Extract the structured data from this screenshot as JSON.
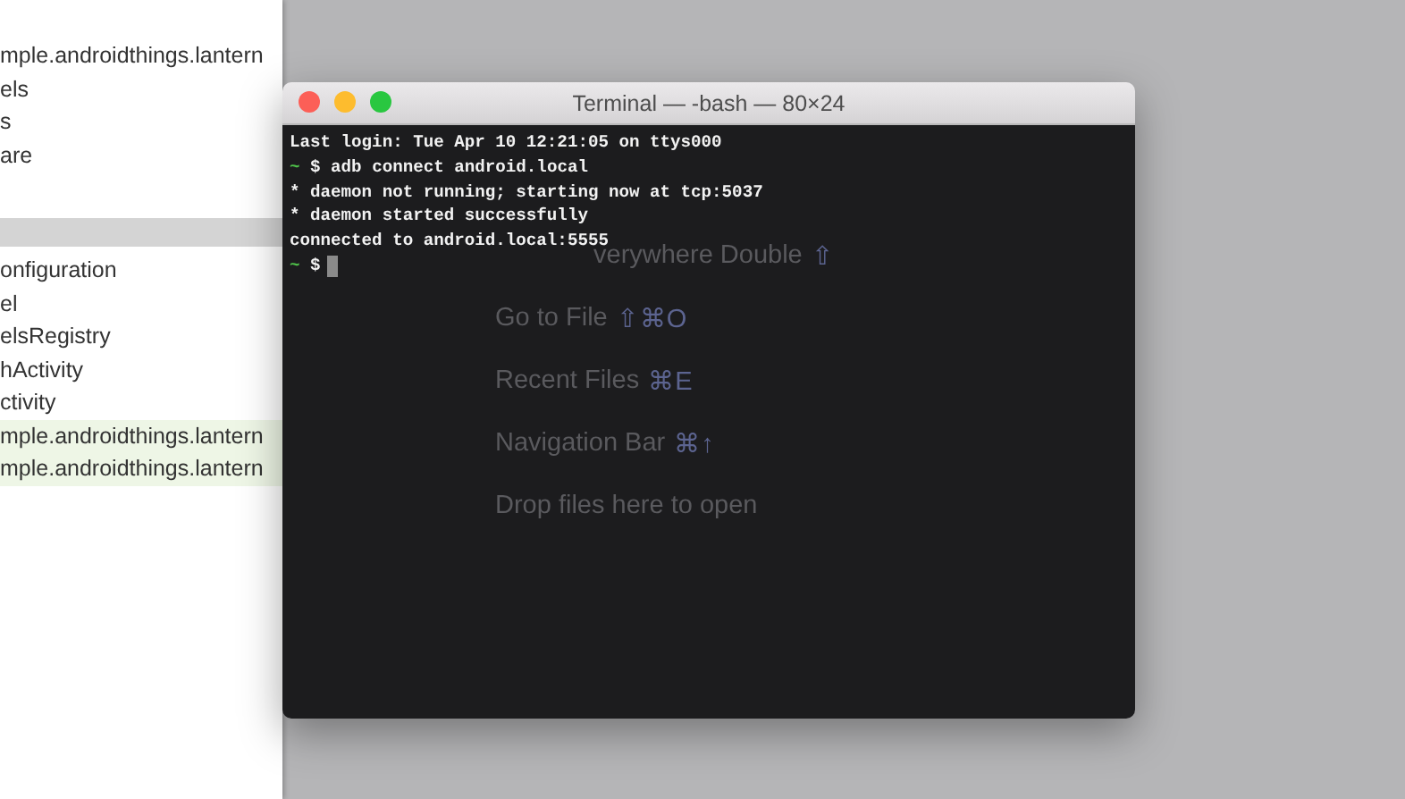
{
  "sidebar": {
    "items": [
      {
        "label": "mple.androidthings.lantern",
        "selected": false,
        "modified": false
      },
      {
        "label": "els",
        "selected": false,
        "modified": false
      },
      {
        "label": "s",
        "selected": false,
        "modified": false
      },
      {
        "label": "are",
        "selected": false,
        "modified": false
      },
      {
        "selected": true,
        "modified": false
      },
      {
        "label": "onfiguration",
        "selected": false,
        "modified": false
      },
      {
        "label": "el",
        "selected": false,
        "modified": false
      },
      {
        "label": "elsRegistry",
        "selected": false,
        "modified": false
      },
      {
        "label": "hActivity",
        "selected": false,
        "modified": false
      },
      {
        "label": "ctivity",
        "selected": false,
        "modified": false
      },
      {
        "label": "mple.androidthings.lantern",
        "selected": false,
        "modified": true
      },
      {
        "label": "mple.androidthings.lantern",
        "selected": false,
        "modified": true
      }
    ]
  },
  "background_hints": [
    {
      "text": "verywhere Double",
      "shortcut": "⇧"
    },
    {
      "text": "Go to File",
      "shortcut": "⇧⌘O"
    },
    {
      "text": "Recent Files",
      "shortcut": "⌘E"
    },
    {
      "text": "Navigation Bar",
      "shortcut": "⌘↑"
    },
    {
      "text": "Drop files here to open"
    }
  ],
  "terminal": {
    "title": "Terminal — -bash — 80×24",
    "lines": [
      {
        "kind": "output",
        "text": "Last login: Tue Apr 10 12:21:05 on ttys000"
      },
      {
        "kind": "prompt",
        "prompt": "~",
        "symbol": "$",
        "text": "adb connect android.local"
      },
      {
        "kind": "output",
        "text": "* daemon not running; starting now at tcp:5037"
      },
      {
        "kind": "output",
        "text": "* daemon started successfully"
      },
      {
        "kind": "output",
        "text": "connected to android.local:5555"
      },
      {
        "kind": "prompt",
        "prompt": "~",
        "symbol": "$",
        "cursor": true
      }
    ]
  }
}
